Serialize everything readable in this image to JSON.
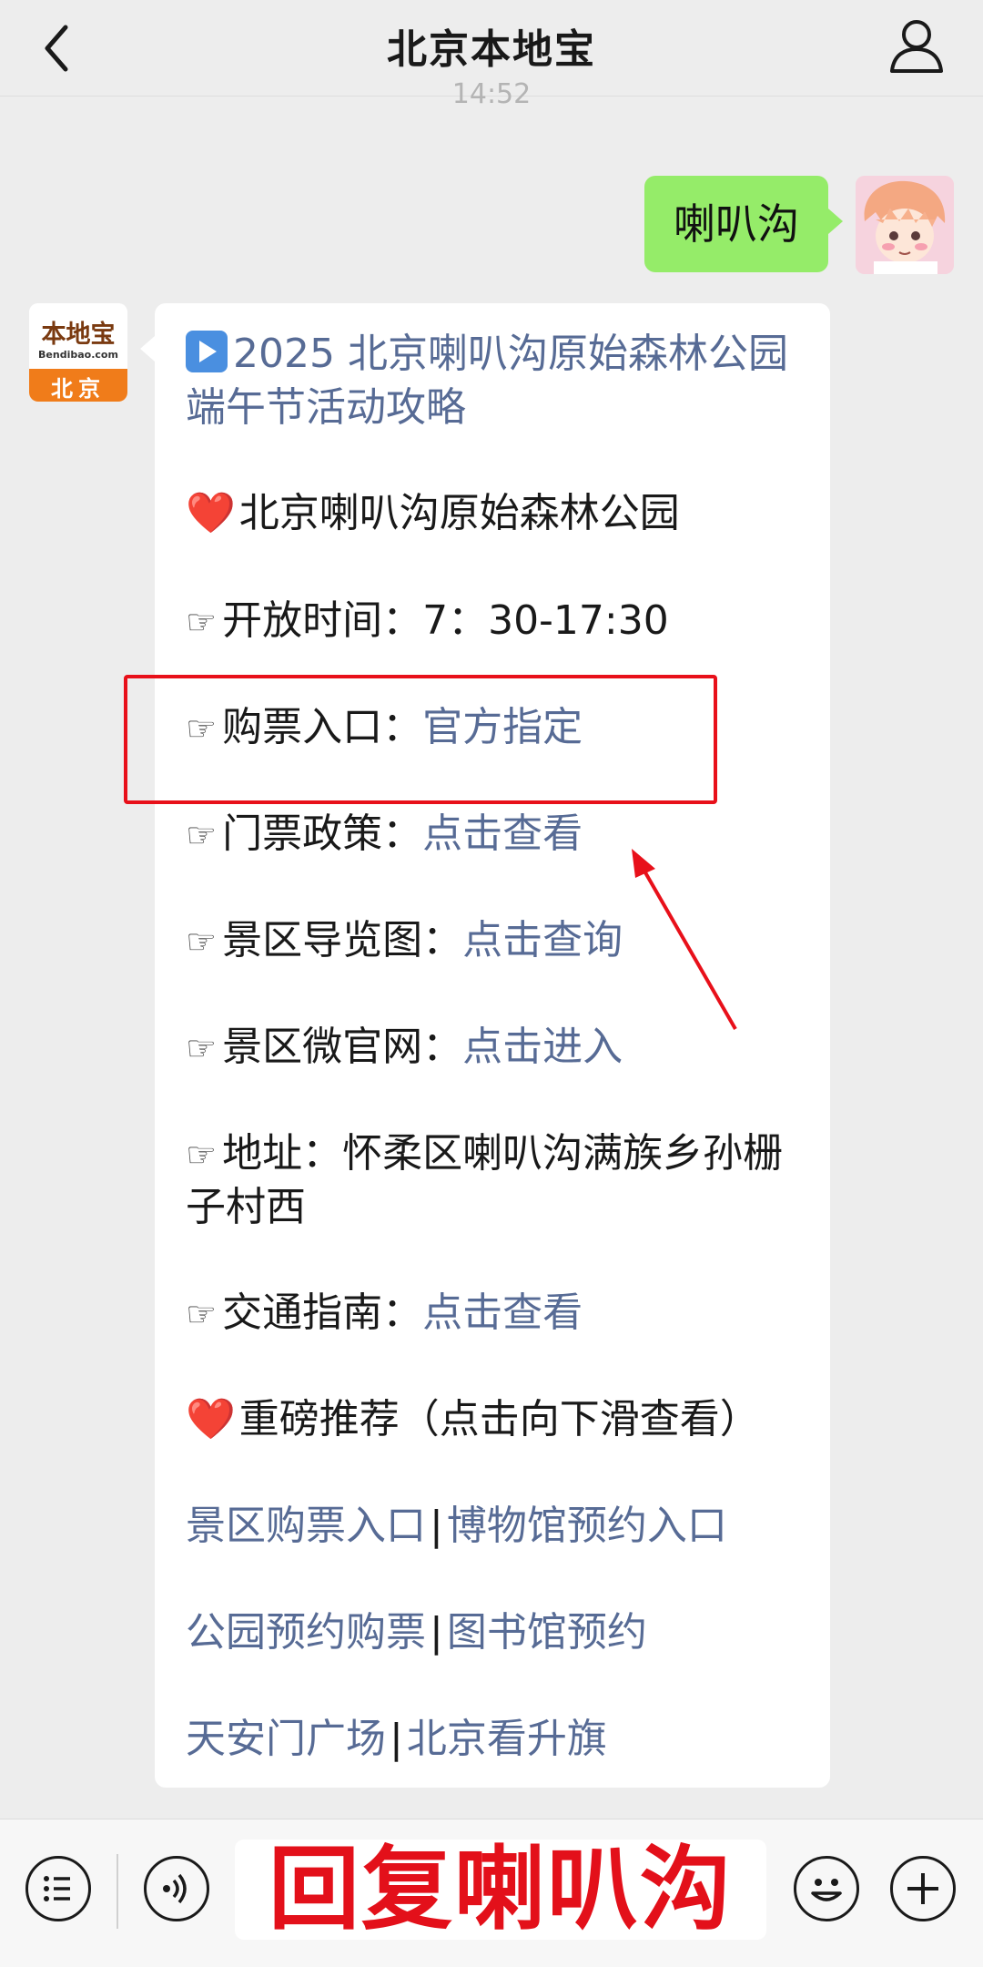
{
  "header": {
    "title": "北京本地宝"
  },
  "chat": {
    "time": "14:52",
    "outgoing": {
      "text": "喇叭沟"
    },
    "bot_avatar": {
      "logo_text": "本地宝",
      "logo_sub": "Bendibao.com",
      "city": "北京"
    },
    "incoming": {
      "headline_line1": "2025 北京喇叭沟原始森林公园",
      "headline_line2": "端午节活动攻略",
      "park_name": "北京喇叭沟原始森林公园",
      "pointer": "☞",
      "heart": "❤️",
      "open_label": "开放时间：",
      "open_value": "7：30-17:30",
      "ticket_label": "购票入口：",
      "ticket_link": "官方指定",
      "policy_label": "门票政策：",
      "policy_link": "点击查看",
      "map_label": "景区导览图：",
      "map_link": "点击查询",
      "site_label": "景区微官网：",
      "site_link": "点击进入",
      "address_line1": "地址：怀柔区喇叭沟满族乡孙栅",
      "address_line2": "子村西",
      "traffic_label": "交通指南：",
      "traffic_link": "点击查看",
      "recommend": "重磅推荐（点击向下滑查看）",
      "sep": "|",
      "links_row1": [
        "景区购票入口",
        "博物馆预约入口"
      ],
      "links_row2": [
        "公园预约购票",
        "图书馆预约"
      ],
      "links_row3": [
        "天安门广场",
        "北京看升旗"
      ]
    }
  },
  "bottom": {
    "reply_banner": "回复喇叭沟"
  },
  "colors": {
    "bubble_out": "#95ec69",
    "link": "#576b95",
    "annotation": "#e8101a"
  }
}
